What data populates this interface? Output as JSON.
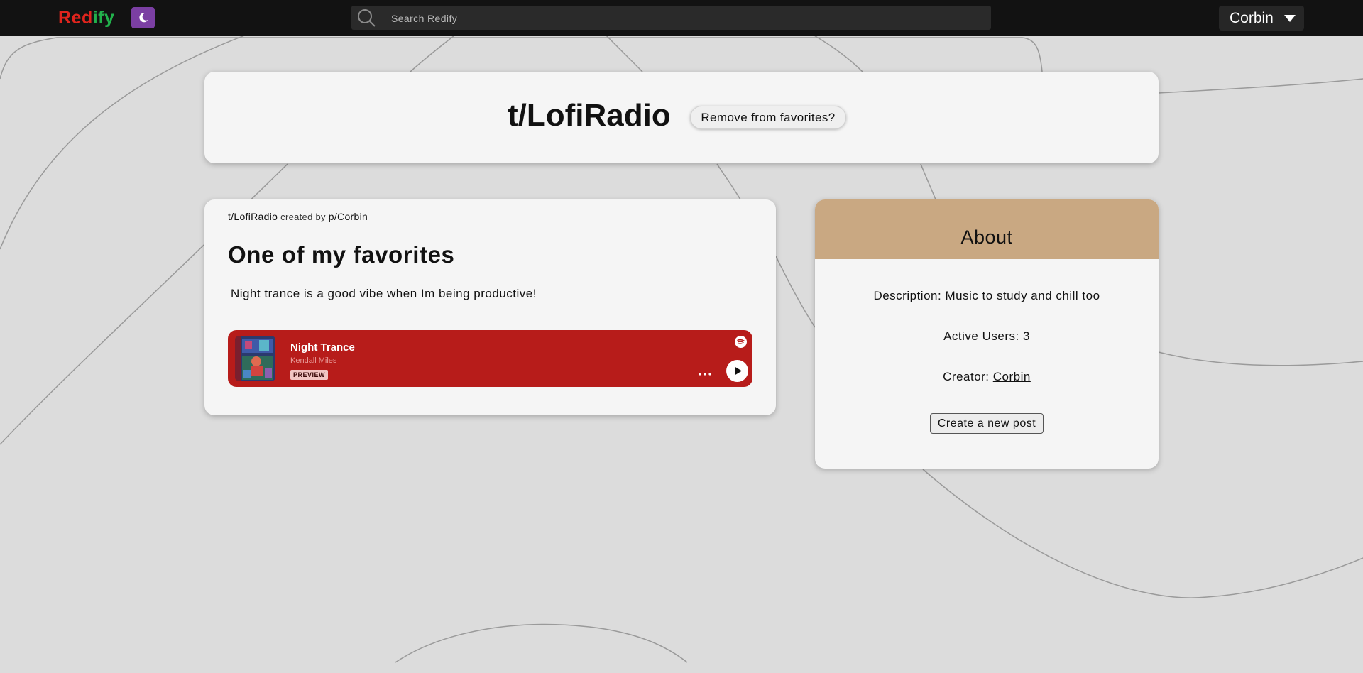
{
  "app": {
    "logo_prefix": "Red",
    "logo_suffix": "ify",
    "search_placeholder": "Search Redify",
    "user_name": "Corbin",
    "colors": {
      "brand_red": "#e0241d",
      "brand_green": "#22b14c",
      "toggle_purple": "#7b3fa3",
      "embed_red": "#b71c1a",
      "about_header": "#c9a882"
    },
    "icons": {
      "theme": "moon-icon",
      "search": "search-icon",
      "user_menu": "caret-down-icon"
    }
  },
  "community": {
    "title": "t/LofiRadio",
    "favorite_button": "Remove from favorites?"
  },
  "post": {
    "community_link": "t/LofiRadio",
    "created_by": "created by",
    "author_link": "p/Corbin",
    "title": "One of my favorites",
    "body": "Night trance is a good vibe when Im being productive!",
    "embed": {
      "track": "Night Trance",
      "artist": "Kendall Miles",
      "badge": "PREVIEW",
      "icons": {
        "service": "spotify-icon",
        "more": "more-icon",
        "play": "play-icon"
      }
    }
  },
  "about": {
    "title": "About",
    "description_label": "Description: ",
    "description": "Music to study and chill too",
    "active_users_label": "Active Users: ",
    "active_users": "3",
    "creator_label": "Creator: ",
    "creator": "Corbin",
    "create_post_button": "Create a new post"
  }
}
